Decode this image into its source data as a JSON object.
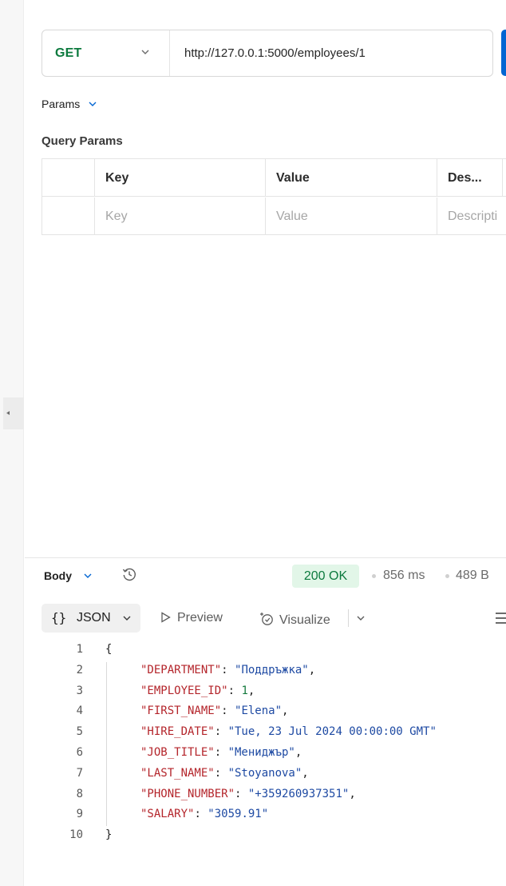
{
  "request": {
    "method": "GET",
    "url": "http://127.0.0.1:5000/employees/1"
  },
  "tabs": {
    "params_label": "Params"
  },
  "query_params": {
    "title": "Query Params",
    "headers": [
      "Key",
      "Value",
      "Des..."
    ],
    "placeholders": [
      "Key",
      "Value",
      "Descripti"
    ]
  },
  "response": {
    "body_label": "Body",
    "status": "200 OK",
    "status_color": "#0c7a3e",
    "time": "856 ms",
    "size": "489 B",
    "format": "JSON",
    "preview_label": "Preview",
    "visualize_label": "Visualize",
    "lines": [
      {
        "n": "1",
        "open": "{"
      },
      {
        "n": "2",
        "key": "\"DEPARTMENT\"",
        "value": "\"Поддръжка\"",
        "type": "string",
        "comma": ","
      },
      {
        "n": "3",
        "key": "\"EMPLOYEE_ID\"",
        "value": "1",
        "type": "number",
        "comma": ","
      },
      {
        "n": "4",
        "key": "\"FIRST_NAME\"",
        "value": "\"Elena\"",
        "type": "string",
        "comma": ","
      },
      {
        "n": "5",
        "key": "\"HIRE_DATE\"",
        "value": "\"Tue, 23 Jul 2024 00:00:00 GMT\"",
        "type": "string",
        "comma": ""
      },
      {
        "n": "6",
        "key": "\"JOB_TITLE\"",
        "value": "\"Мениджър\"",
        "type": "string",
        "comma": ","
      },
      {
        "n": "7",
        "key": "\"LAST_NAME\"",
        "value": "\"Stoyanova\"",
        "type": "string",
        "comma": ","
      },
      {
        "n": "8",
        "key": "\"PHONE_NUMBER\"",
        "value": "\"+359260937351\"",
        "type": "string",
        "comma": ","
      },
      {
        "n": "9",
        "key": "\"SALARY\"",
        "value": "\"3059.91\"",
        "type": "string",
        "comma": ""
      },
      {
        "n": "10",
        "open": "}"
      }
    ]
  },
  "icons": [
    "chevron-down-icon",
    "history-icon",
    "play-icon",
    "visualize-icon",
    "filter-icon"
  ]
}
